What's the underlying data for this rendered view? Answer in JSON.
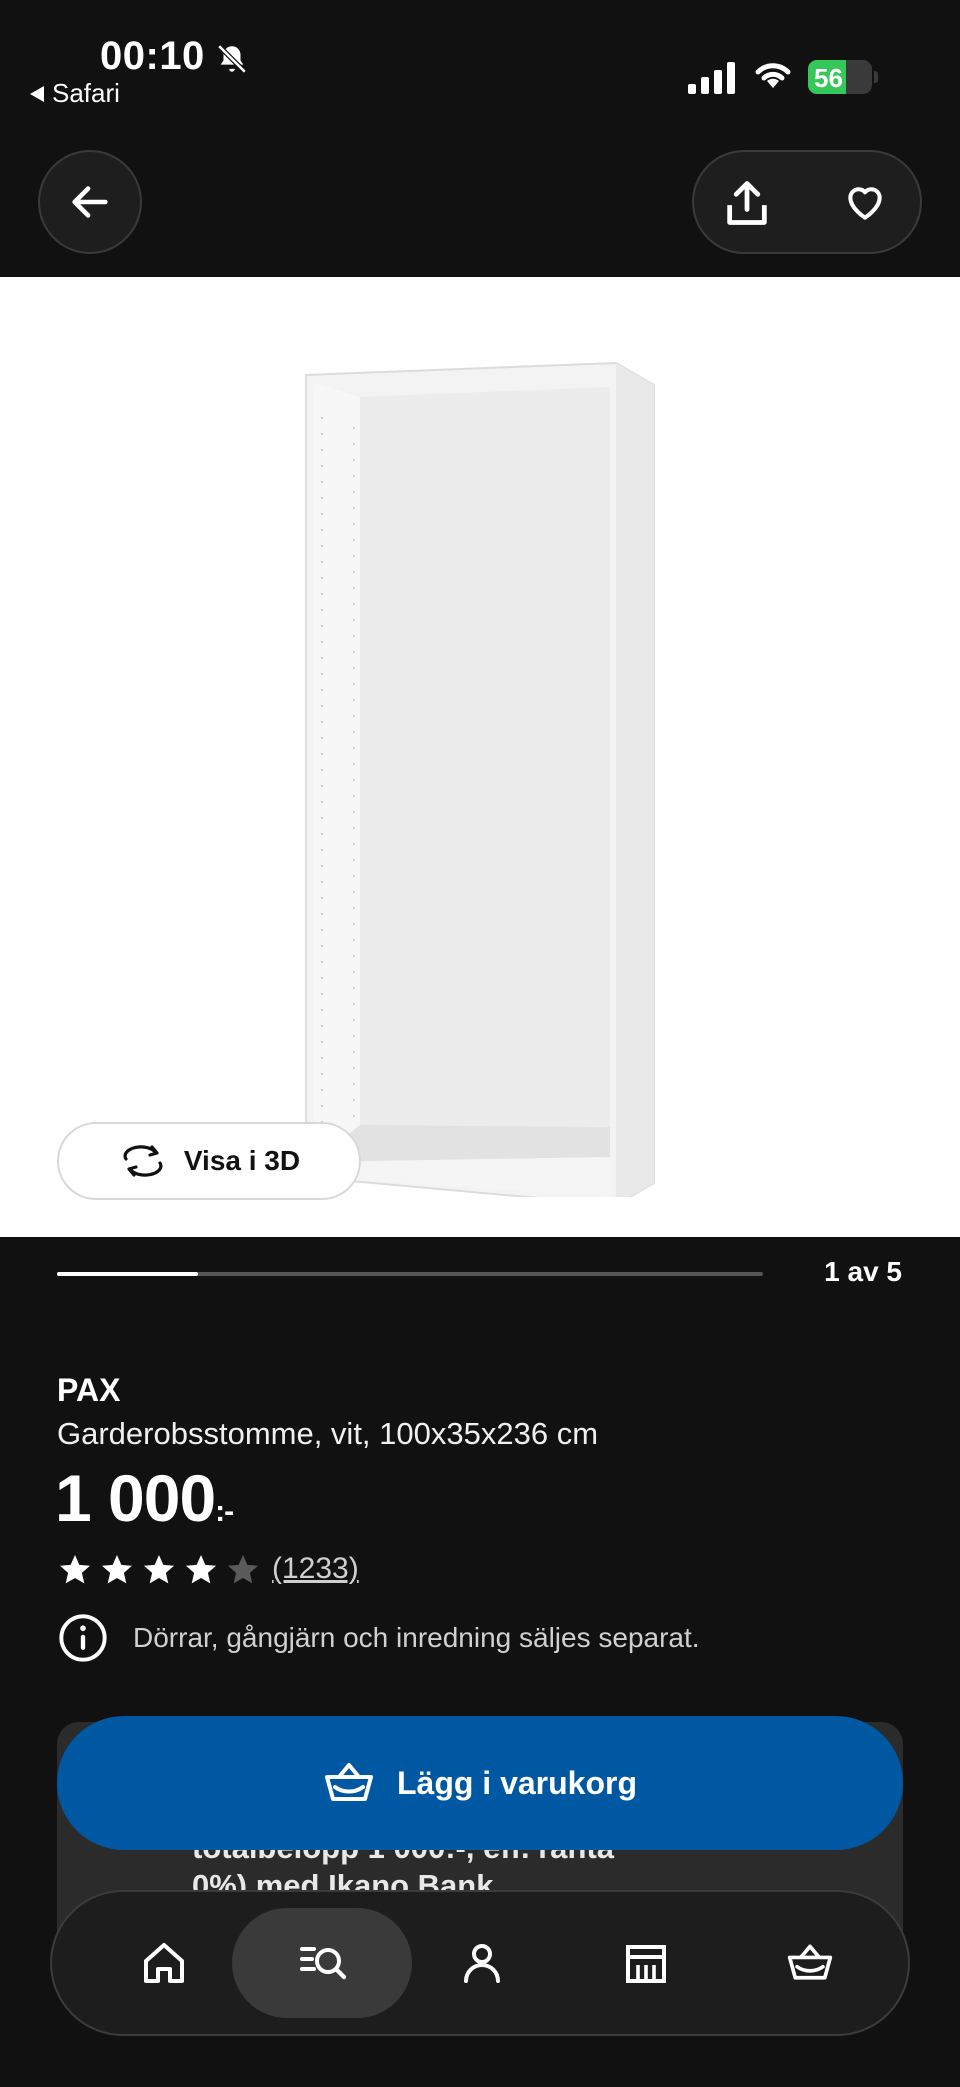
{
  "status_bar": {
    "time": "00:10",
    "back_app": "Safari",
    "battery": "56"
  },
  "header": {
    "back_icon": "arrow-left-icon",
    "share_icon": "share-upload-icon",
    "favorite_icon": "heart-icon"
  },
  "gallery": {
    "view_3d_label": "Visa i 3D",
    "page_counter": "1 av 5",
    "progress": 0.2
  },
  "product": {
    "brand": "PAX",
    "description": "Garderobsstomme, vit, 100x35x236 cm",
    "price": "1 000",
    "price_suffix": ":-",
    "rating": 4,
    "rating_max": 5,
    "review_count": "(1233)",
    "notice": "Dörrar, gångjärn och inredning säljes separat."
  },
  "promo": {
    "line1": "totalbelopp 1 000:-, eff. ränta",
    "line2": "0%) med Ikano Bank"
  },
  "cart": {
    "add_label": "Lägg i varukorg"
  },
  "bottom_nav": {
    "items": [
      {
        "name": "home",
        "icon": "home-icon",
        "active": false
      },
      {
        "name": "search",
        "icon": "search-list-icon",
        "active": true
      },
      {
        "name": "profile",
        "icon": "person-icon",
        "active": false
      },
      {
        "name": "stores",
        "icon": "store-icon",
        "active": false
      },
      {
        "name": "basket",
        "icon": "basket-icon",
        "active": false
      }
    ]
  },
  "colors": {
    "background": "#111111",
    "accent_blue": "#0058a3",
    "battery_green": "#35c759"
  }
}
